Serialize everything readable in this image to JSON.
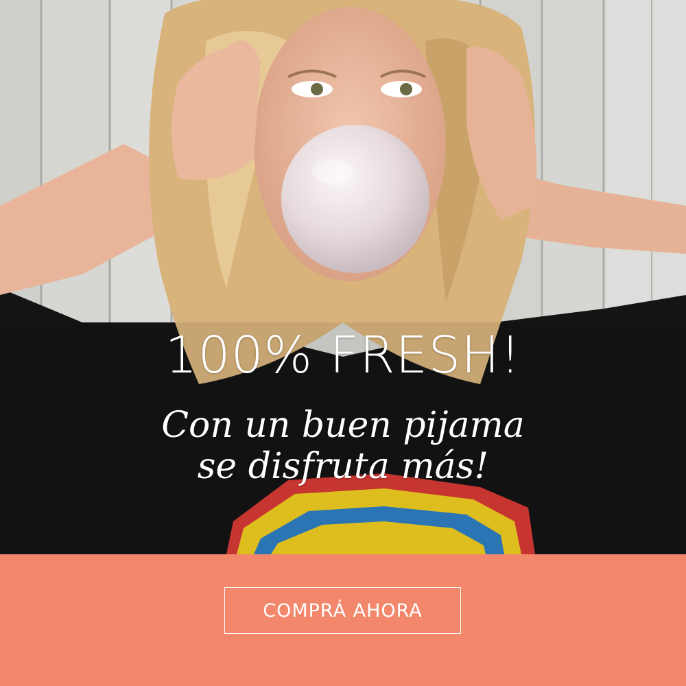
{
  "hero": {
    "headline": "100% FRESH!",
    "tagline_line1": "Con un buen pijama",
    "tagline_line2": "se disfruta más!"
  },
  "cta": {
    "label": "COMPRÁ AHORA"
  },
  "colors": {
    "cta_bar": "#f3876c",
    "text": "#ffffff",
    "shirt": "#111111",
    "hair": "#d8b47c",
    "bubble": "#e9dee0"
  }
}
